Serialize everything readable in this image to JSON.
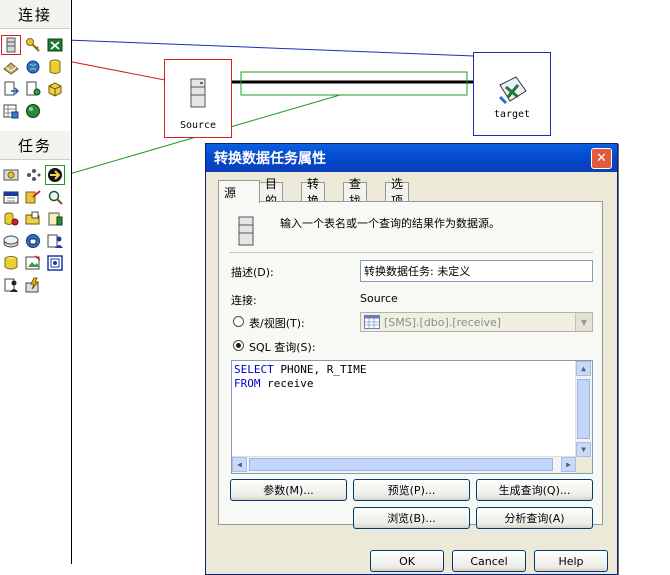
{
  "palette": {
    "connections_header": "连接",
    "tasks_header": "任务",
    "connection_tools": [
      {
        "icon": "sql-server-db-icon"
      },
      {
        "icon": "key-icon"
      },
      {
        "icon": "excel-icon"
      },
      {
        "icon": "text-file-icon"
      },
      {
        "icon": "globe-icon"
      },
      {
        "icon": "cylinder-db-icon"
      },
      {
        "icon": "doc-arrow-icon"
      },
      {
        "icon": "doc-out-icon"
      },
      {
        "icon": "box-icon"
      },
      {
        "icon": "grid-doc-icon"
      },
      {
        "icon": "green-circle-icon"
      }
    ],
    "task_tools": [
      {
        "icon": "transform-task-icon"
      },
      {
        "icon": "dots-task-icon"
      },
      {
        "icon": "arrow-task-icon"
      },
      {
        "icon": "calendar-icon"
      },
      {
        "icon": "paint-icon"
      },
      {
        "icon": "magnify-icon"
      },
      {
        "icon": "db-gear-icon"
      },
      {
        "icon": "folder-open-icon"
      },
      {
        "icon": "notepad-icon"
      },
      {
        "icon": "disk-icon"
      },
      {
        "icon": "globe-db-icon"
      },
      {
        "icon": "user-icon"
      },
      {
        "icon": "yellow-db-icon"
      },
      {
        "icon": "image-doc-icon"
      },
      {
        "icon": "frame-icon"
      },
      {
        "icon": "person-doc-icon"
      },
      {
        "icon": "lightning-icon"
      }
    ]
  },
  "canvas": {
    "source_label": "Source",
    "target_label": "target"
  },
  "dialog": {
    "title": "转换数据任务属性",
    "close_glyph": "✕",
    "tabs": [
      "源",
      "目的",
      "转换",
      "查找",
      "选项"
    ],
    "active_tab": 0,
    "source_desc": "输入一个表名或一个查询的结果作为数据源。",
    "desc_label": "描述(D):",
    "desc_value": "转换数据任务: 未定义",
    "conn_label": "连接:",
    "conn_value": "Source",
    "table_radio_label": "表/视图(T):",
    "table_value": "[SMS].[dbo].[receive]",
    "sql_radio_label": "SQL 查询(S):",
    "sql_line1_kw": "SELECT",
    "sql_line1_rest": " PHONE, R_TIME",
    "sql_line2_kw": "FROM",
    "sql_line2_rest": " receive",
    "buttons": {
      "params": "参数(M)...",
      "preview": "预览(P)...",
      "build_query": "生成查询(Q)...",
      "browse": "浏览(B)...",
      "parse_query": "分析查询(A)",
      "ok": "OK",
      "cancel": "Cancel",
      "help": "Help"
    }
  },
  "colors": {
    "red_line": "#d32020",
    "green_line": "#1c9c1c",
    "blue_line": "#1a2fb0"
  }
}
